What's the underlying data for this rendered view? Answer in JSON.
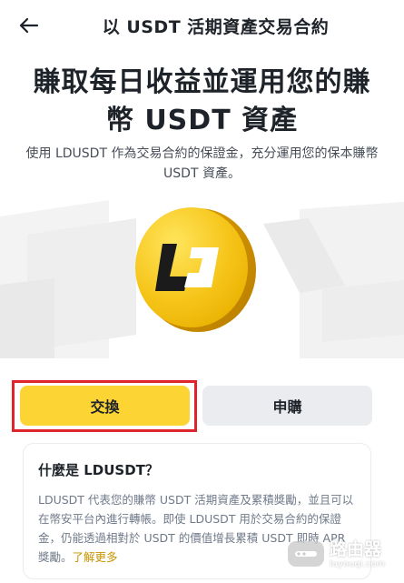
{
  "header": {
    "title": "以 USDT 活期資產交易合約"
  },
  "main": {
    "headline_line1": "賺取每日收益並運用您的賺",
    "headline_line2": "幣 USDT 資產",
    "subtitle": "使用 LDUSDT 作為交易合約的保證金，充分運用您的保本賺幣 USDT 資產。"
  },
  "actions": {
    "swap_label": "交換",
    "subscribe_label": "申購"
  },
  "info": {
    "title": "什麼是 LDUSDT？",
    "body": "LDUSDT 代表您的賺幣 USDT 活期資產及累積獎勵，並且可以在幣安平台內進行轉帳。即使 LDUSDT 用於交易合約的保證金，仍能透過相對於 USDT 的價值增長累積 USDT 即時 APR 獎勵。",
    "link": "了解更多"
  },
  "watermark": {
    "name": "路由器",
    "url": "luyouqi.com"
  },
  "icons": {
    "back": "arrow-left-icon",
    "coin": "ldusdt-coin-icon",
    "watermark": "router-logo-icon"
  },
  "colors": {
    "accent": "#fcd535",
    "secondary_button": "#eaecef",
    "highlight_border": "#e0242d",
    "link": "#c99400",
    "text_primary": "#1e2329",
    "text_secondary": "#707a8a"
  }
}
